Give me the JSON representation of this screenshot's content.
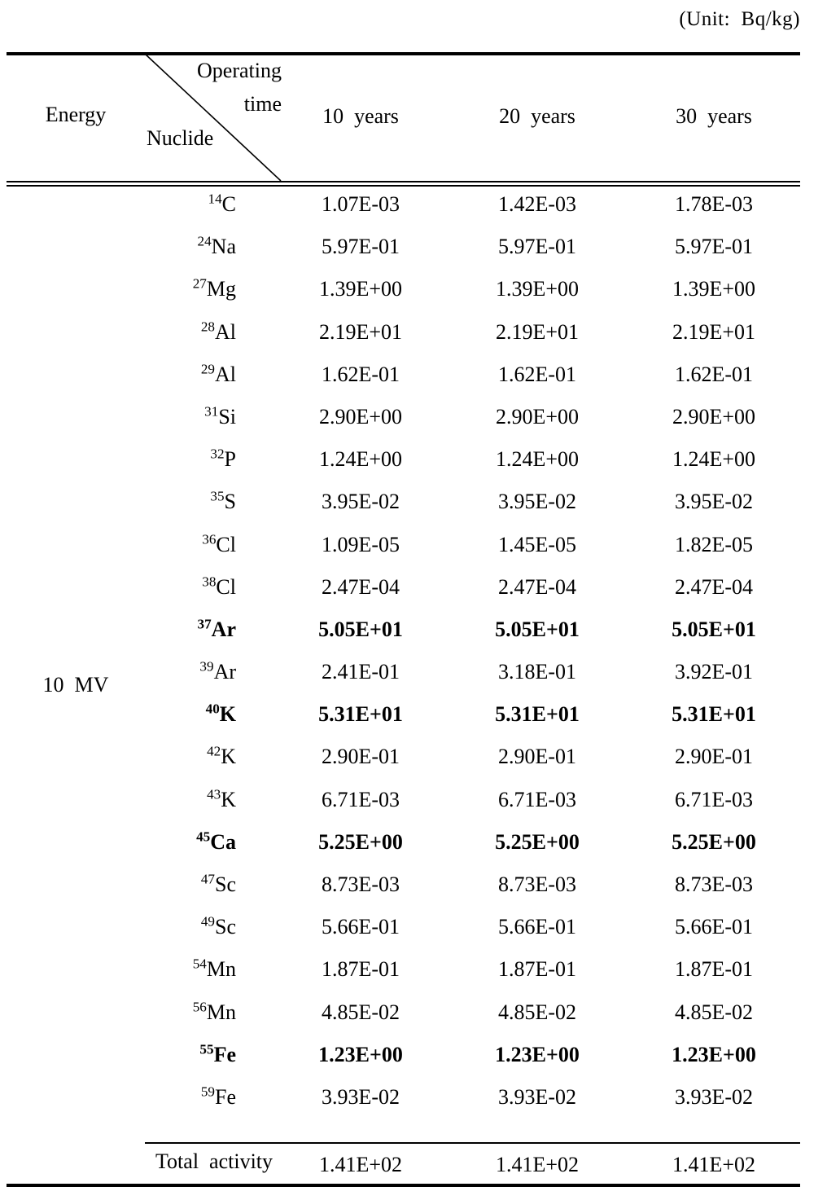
{
  "unit_caption": "(Unit:  Bq/kg)",
  "header": {
    "energy_label": "Energy",
    "diagonal_top_label_line1": "Operating",
    "diagonal_top_label_line2": "time",
    "diagonal_bottom_label": "Nuclide",
    "columns": [
      "10  years",
      "20  years",
      "30  years"
    ]
  },
  "energy_value": "10  MV",
  "total": {
    "label": "Total  activity",
    "values": [
      "1.41E+02",
      "1.41E+02",
      "1.41E+02"
    ]
  },
  "chart_data": {
    "type": "table",
    "title": "Induced radioactivity of nuclides for 10 MV operating time",
    "unit": "Bq/kg",
    "row_header_label": "Nuclide",
    "column_header_label": "Operating time",
    "group_label": "Energy",
    "group_value": "10 MV",
    "categories": [
      "10 years",
      "20 years",
      "30 years"
    ],
    "rows": [
      {
        "mass": "14",
        "element": "C",
        "bold": false,
        "values": [
          "1.07E-03",
          "1.42E-03",
          "1.78E-03"
        ]
      },
      {
        "mass": "24",
        "element": "Na",
        "bold": false,
        "values": [
          "5.97E-01",
          "5.97E-01",
          "5.97E-01"
        ]
      },
      {
        "mass": "27",
        "element": "Mg",
        "bold": false,
        "values": [
          "1.39E+00",
          "1.39E+00",
          "1.39E+00"
        ]
      },
      {
        "mass": "28",
        "element": "Al",
        "bold": false,
        "values": [
          "2.19E+01",
          "2.19E+01",
          "2.19E+01"
        ]
      },
      {
        "mass": "29",
        "element": "Al",
        "bold": false,
        "values": [
          "1.62E-01",
          "1.62E-01",
          "1.62E-01"
        ]
      },
      {
        "mass": "31",
        "element": "Si",
        "bold": false,
        "values": [
          "2.90E+00",
          "2.90E+00",
          "2.90E+00"
        ]
      },
      {
        "mass": "32",
        "element": "P",
        "bold": false,
        "values": [
          "1.24E+00",
          "1.24E+00",
          "1.24E+00"
        ]
      },
      {
        "mass": "35",
        "element": "S",
        "bold": false,
        "values": [
          "3.95E-02",
          "3.95E-02",
          "3.95E-02"
        ]
      },
      {
        "mass": "36",
        "element": "Cl",
        "bold": false,
        "values": [
          "1.09E-05",
          "1.45E-05",
          "1.82E-05"
        ]
      },
      {
        "mass": "38",
        "element": "Cl",
        "bold": false,
        "values": [
          "2.47E-04",
          "2.47E-04",
          "2.47E-04"
        ]
      },
      {
        "mass": "37",
        "element": "Ar",
        "bold": true,
        "values": [
          "5.05E+01",
          "5.05E+01",
          "5.05E+01"
        ]
      },
      {
        "mass": "39",
        "element": "Ar",
        "bold": false,
        "values": [
          "2.41E-01",
          "3.18E-01",
          "3.92E-01"
        ]
      },
      {
        "mass": "40",
        "element": "K",
        "bold": true,
        "values": [
          "5.31E+01",
          "5.31E+01",
          "5.31E+01"
        ]
      },
      {
        "mass": "42",
        "element": "K",
        "bold": false,
        "values": [
          "2.90E-01",
          "2.90E-01",
          "2.90E-01"
        ]
      },
      {
        "mass": "43",
        "element": "K",
        "bold": false,
        "values": [
          "6.71E-03",
          "6.71E-03",
          "6.71E-03"
        ]
      },
      {
        "mass": "45",
        "element": "Ca",
        "bold": true,
        "values": [
          "5.25E+00",
          "5.25E+00",
          "5.25E+00"
        ]
      },
      {
        "mass": "47",
        "element": "Sc",
        "bold": false,
        "values": [
          "8.73E-03",
          "8.73E-03",
          "8.73E-03"
        ]
      },
      {
        "mass": "49",
        "element": "Sc",
        "bold": false,
        "values": [
          "5.66E-01",
          "5.66E-01",
          "5.66E-01"
        ]
      },
      {
        "mass": "54",
        "element": "Mn",
        "bold": false,
        "values": [
          "1.87E-01",
          "1.87E-01",
          "1.87E-01"
        ]
      },
      {
        "mass": "56",
        "element": "Mn",
        "bold": false,
        "values": [
          "4.85E-02",
          "4.85E-02",
          "4.85E-02"
        ]
      },
      {
        "mass": "55",
        "element": "Fe",
        "bold": true,
        "values": [
          "1.23E+00",
          "1.23E+00",
          "1.23E+00"
        ]
      },
      {
        "mass": "59",
        "element": "Fe",
        "bold": false,
        "values": [
          "3.93E-02",
          "3.93E-02",
          "3.93E-02"
        ]
      }
    ],
    "total_row": {
      "label": "Total activity",
      "values": [
        "1.41E+02",
        "1.41E+02",
        "1.41E+02"
      ]
    }
  }
}
